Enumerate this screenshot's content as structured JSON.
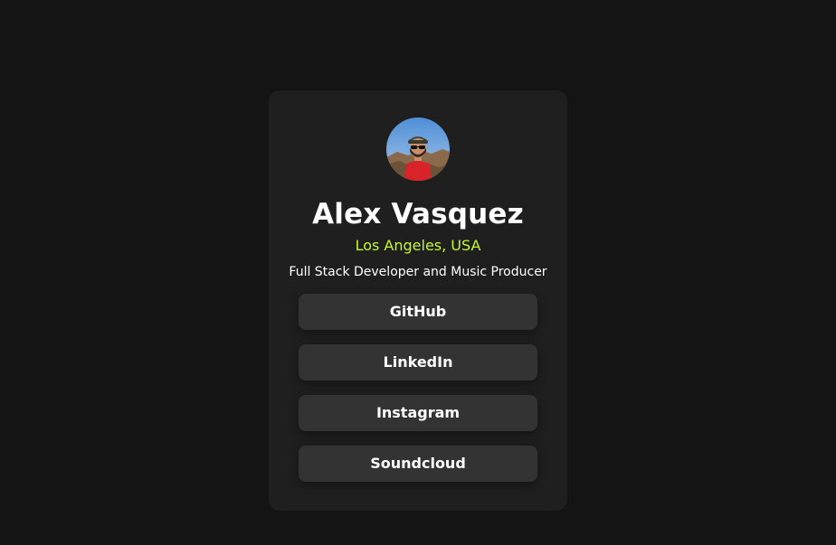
{
  "profile": {
    "name": "Alex Vasquez",
    "location": "Los Angeles, USA",
    "bio": "Full Stack Developer and Music Producer",
    "avatar_icon": "profile-photo"
  },
  "links": [
    {
      "label": "GitHub"
    },
    {
      "label": "LinkedIn"
    },
    {
      "label": "Instagram"
    },
    {
      "label": "Soundcloud"
    }
  ],
  "colors": {
    "background": "#141414",
    "card": "#1f1f1f",
    "button": "#333333",
    "accent": "#c4f82a",
    "text": "#ffffff"
  }
}
